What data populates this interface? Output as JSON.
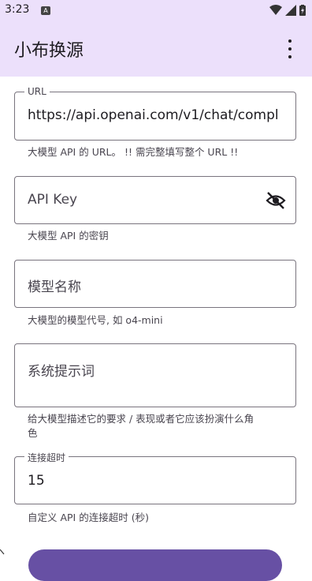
{
  "status_bar": {
    "time": "3:23",
    "notification": "A"
  },
  "app_bar": {
    "title": "小布换源",
    "overflow_icon": "more-vert-icon"
  },
  "fields": {
    "url": {
      "label": "URL",
      "value": "https://api.openai.com/v1/chat/compl",
      "helper": "大模型 API 的 URL。 !! 需完整填写整个 URL !!"
    },
    "api_key": {
      "placeholder": "API Key",
      "helper": "大模型 API 的密钥",
      "icon": "visibility-off-icon"
    },
    "model_name": {
      "placeholder": "模型名称",
      "helper": "大模型的模型代号, 如 o4-mini"
    },
    "system_prompt": {
      "placeholder": "系统提示词",
      "helper_line1": "给大模型描述它的要求 / 表现或者它应该扮演什么角",
      "helper_line2": "色"
    },
    "timeout": {
      "label": "连接超时",
      "value": "15",
      "helper": "自定义 API 的连接超时 (秒)"
    }
  },
  "colors": {
    "app_bar_bg": "#ece0fb",
    "primary": "#6750a4",
    "outline": "#79747e"
  }
}
